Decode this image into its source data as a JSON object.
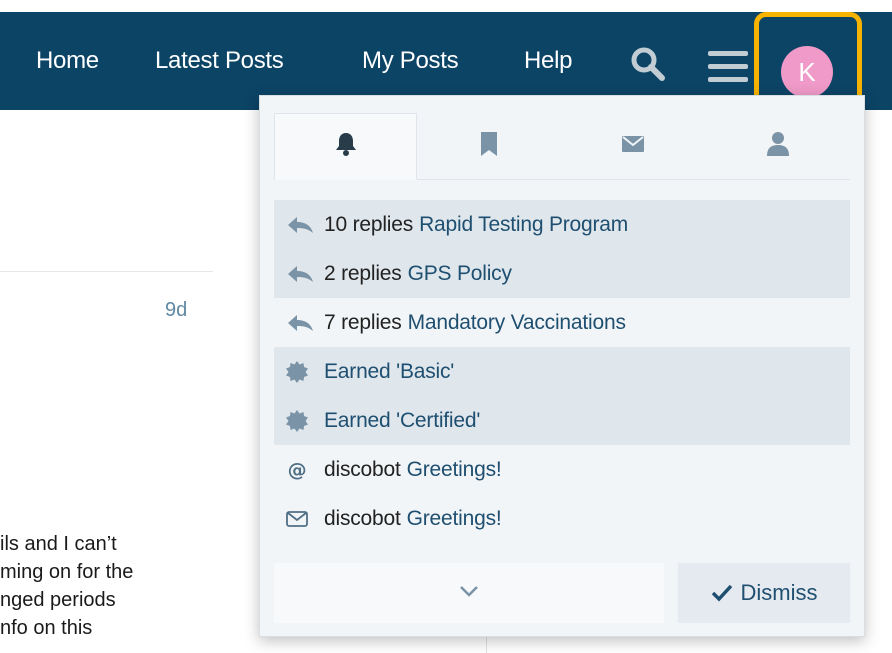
{
  "nav": {
    "links": [
      "Home",
      "Latest Posts",
      "My Posts",
      "Help"
    ],
    "search_icon": "search-icon",
    "menu_icon": "hamburger-menu-icon",
    "avatar_letter": "K",
    "avatar_color": "#ef9ac8",
    "header_color": "#0c4466",
    "highlight_color": "#f6b300"
  },
  "background_post": {
    "age": "9d",
    "excerpt_lines": [
      "ils and I can’t",
      "ming on for the",
      "nged periods",
      "nfo on this"
    ]
  },
  "panel": {
    "tabs": [
      {
        "icon": "bell-icon",
        "active": true
      },
      {
        "icon": "bookmark-icon",
        "active": false
      },
      {
        "icon": "envelope-icon",
        "active": false
      },
      {
        "icon": "user-icon",
        "active": false
      }
    ],
    "notifications": [
      {
        "icon": "reply-icon",
        "name": "10 replies",
        "title": "Rapid Testing Program",
        "unread": true
      },
      {
        "icon": "reply-icon",
        "name": "2 replies",
        "title": "GPS Policy",
        "unread": true
      },
      {
        "icon": "reply-icon",
        "name": "7 replies",
        "title": "Mandatory Vaccinations",
        "unread": false
      },
      {
        "icon": "badge-icon",
        "name": "",
        "title": "Earned 'Basic'",
        "unread": true
      },
      {
        "icon": "badge-icon",
        "name": "",
        "title": "Earned 'Certified'",
        "unread": true
      },
      {
        "icon": "at-mention-icon",
        "name": "discobot",
        "title": "Greetings!",
        "unread": false
      },
      {
        "icon": "envelope-icon",
        "name": "discobot",
        "title": "Greetings!",
        "unread": false
      }
    ],
    "more_icon": "chevron-down-icon",
    "dismiss_label": "Dismiss"
  }
}
